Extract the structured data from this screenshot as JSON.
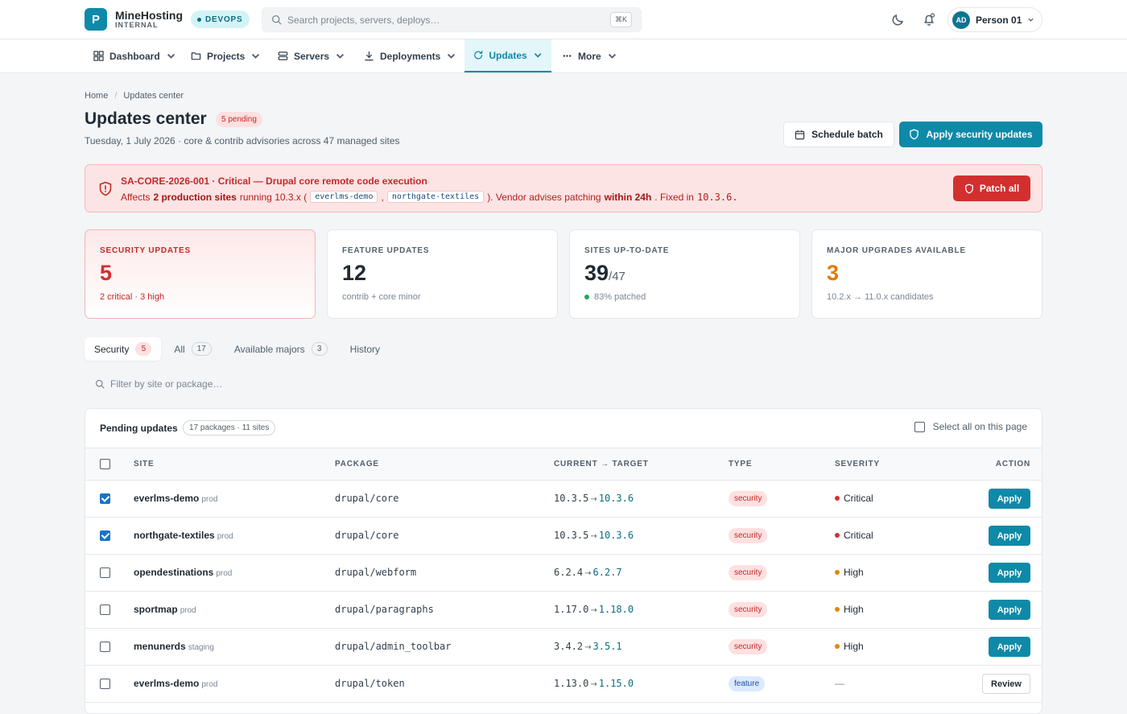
{
  "brand": {
    "logo_letter": "P",
    "name": "MineHosting",
    "sub": "INTERNAL",
    "env_badge": "DEVOPS"
  },
  "search": {
    "placeholder": "Search projects, servers, deploys…",
    "shortcut": "⌘K"
  },
  "user": {
    "initials": "AD",
    "name": "Person 01"
  },
  "nav": {
    "items": [
      {
        "label": "Dashboard",
        "icon": "grid-icon"
      },
      {
        "label": "Projects",
        "icon": "folder-icon"
      },
      {
        "label": "Servers",
        "icon": "server-icon"
      },
      {
        "label": "Deployments",
        "icon": "download-icon"
      },
      {
        "label": "Updates",
        "icon": "refresh-icon",
        "active": true
      },
      {
        "label": "More",
        "icon": "ellipsis-icon"
      }
    ]
  },
  "breadcrumb": {
    "home": "Home",
    "current": "Updates center"
  },
  "header": {
    "title": "Updates center",
    "pending_badge": "5 pending",
    "subtitle": "Tuesday, 1 July 2026 · core & contrib advisories across 47 managed sites",
    "schedule_label": "Schedule batch",
    "apply_label": "Apply security updates"
  },
  "alert": {
    "title": "SA-CORE-2026-001 · Critical — Drupal core remote code execution",
    "text_affects": "Affects",
    "text_prod_sites": "2 production sites",
    "text_running": "running 10.3.x (",
    "chip_1": "everlms-demo",
    "comma": ",",
    "chip_2": "northgate-textiles",
    "text_vendor": "). Vendor advises patching",
    "text_within": "within 24h",
    "text_fixed": ". Fixed in",
    "fixed_version": "10.3.6.",
    "button": "Patch all"
  },
  "stats": [
    {
      "label": "SECURITY UPDATES",
      "value": "5",
      "sub": "2 critical · 3 high",
      "accent": "#d32f2f"
    },
    {
      "label": "FEATURE UPDATES",
      "value": "12",
      "sub": "contrib + core minor"
    },
    {
      "label": "SITES UP-TO-DATE",
      "value": "39",
      "of": "/47",
      "sub": "83% patched"
    },
    {
      "label": "MAJOR UPGRADES AVAILABLE",
      "value": "3",
      "sub": "10.2.x → 11.0.x candidates",
      "accent": "#e07b00"
    }
  ],
  "tabs": [
    {
      "label": "Security",
      "count": "5",
      "active": true
    },
    {
      "label": "All",
      "count": "17"
    },
    {
      "label": "Available majors",
      "count": "3"
    },
    {
      "label": "History"
    }
  ],
  "filter": {
    "placeholder": "Filter by site or package…"
  },
  "table": {
    "title": "Pending updates",
    "badge": "17 packages · 11 sites",
    "select_all": "Select all on this page",
    "columns": [
      "SITE",
      "PACKAGE",
      "CURRENT → TARGET",
      "TYPE",
      "SEVERITY",
      "ACTION"
    ],
    "rows": [
      {
        "checked": true,
        "site": "everlms-demo",
        "env": "prod",
        "package": "drupal/core",
        "current": "10.3.5",
        "target": "10.3.6",
        "type": "security",
        "severity": "Critical",
        "sev_color": "#d32f2f",
        "action": "Apply"
      },
      {
        "checked": true,
        "site": "northgate-textiles",
        "env": "prod",
        "package": "drupal/core",
        "current": "10.3.5",
        "target": "10.3.6",
        "type": "security",
        "severity": "Critical",
        "sev_color": "#d32f2f",
        "action": "Apply"
      },
      {
        "checked": false,
        "site": "opendestinations",
        "env": "prod",
        "package": "drupal/webform",
        "current": "6.2.4",
        "target": "6.2.7",
        "type": "security",
        "severity": "High",
        "sev_color": "#e08a00",
        "action": "Apply"
      },
      {
        "checked": false,
        "site": "sportmap",
        "env": "prod",
        "package": "drupal/paragraphs",
        "current": "1.17.0",
        "target": "1.18.0",
        "type": "security",
        "severity": "High",
        "sev_color": "#e08a00",
        "action": "Apply"
      },
      {
        "checked": false,
        "site": "menunerds",
        "env": "staging",
        "package": "drupal/admin_toolbar",
        "current": "3.4.2",
        "target": "3.5.1",
        "type": "security",
        "severity": "High",
        "sev_color": "#e08a00",
        "action": "Apply"
      },
      {
        "checked": false,
        "site": "everlms-demo",
        "env": "prod",
        "package": "drupal/token",
        "current": "1.13.0",
        "target": "1.15.0",
        "type": "feature",
        "severity": "—",
        "sev_color": "",
        "action": "Review"
      }
    ]
  }
}
